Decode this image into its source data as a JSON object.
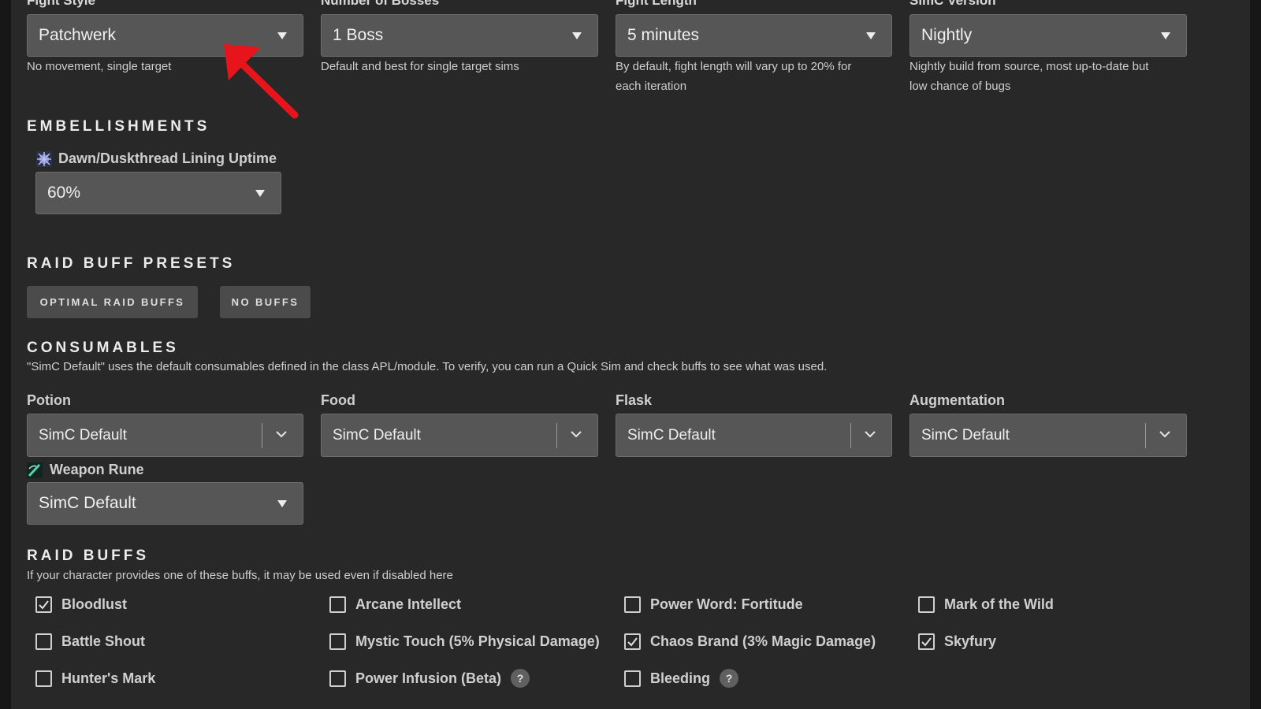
{
  "fight": {
    "style": {
      "label": "Fight Style",
      "value": "Patchwerk",
      "helper": "No movement, single target"
    },
    "bosses": {
      "label": "Number of Bosses",
      "value": "1 Boss",
      "helper": "Default and best for single target sims"
    },
    "length": {
      "label": "Fight Length",
      "value": "5 minutes",
      "helper_line1": "By default, fight length will vary up to 20% for",
      "helper_line2": "each iteration"
    },
    "version": {
      "label": "SimC Version",
      "value": "Nightly",
      "helper_line1": "Nightly build from source, most up-to-date but",
      "helper_line2": "low chance of bugs"
    }
  },
  "embellishments": {
    "heading": "EMBELLISHMENTS",
    "lining_label": "Dawn/Duskthread Lining Uptime",
    "lining_value": "60%",
    "lining_icon": "lining-icon"
  },
  "raid_buff_presets": {
    "heading": "RAID BUFF PRESETS",
    "optimal": "OPTIMAL RAID BUFFS",
    "none": "NO BUFFS"
  },
  "consumables": {
    "heading": "CONSUMABLES",
    "note": "\"SimC Default\" uses the default consumables defined in the class APL/module. To verify, you can run a Quick Sim and check buffs to see what was used.",
    "potion": {
      "label": "Potion",
      "value": "SimC Default"
    },
    "food": {
      "label": "Food",
      "value": "SimC Default"
    },
    "flask": {
      "label": "Flask",
      "value": "SimC Default"
    },
    "augmentation": {
      "label": "Augmentation",
      "value": "SimC Default"
    },
    "weapon_rune": {
      "label": "Weapon Rune",
      "value": "SimC Default",
      "icon": "weapon-rune-icon"
    }
  },
  "raid_buffs": {
    "heading": "RAID BUFFS",
    "note": "If your character provides one of these buffs, it may be used even if disabled here",
    "items": [
      {
        "label": "Bloodlust",
        "checked": true
      },
      {
        "label": "Arcane Intellect",
        "checked": false
      },
      {
        "label": "Power Word: Fortitude",
        "checked": false
      },
      {
        "label": "Mark of the Wild",
        "checked": false
      },
      {
        "label": "Battle Shout",
        "checked": false
      },
      {
        "label": "Mystic Touch (5% Physical Damage)",
        "checked": false
      },
      {
        "label": "Chaos Brand (3% Magic Damage)",
        "checked": true
      },
      {
        "label": "Skyfury",
        "checked": true
      },
      {
        "label": "Hunter's Mark",
        "checked": false
      },
      {
        "label": "Power Infusion (Beta)",
        "checked": false
      },
      {
        "label": "Bleeding",
        "checked": false
      }
    ],
    "help_glyph": "?"
  },
  "annotation": {
    "arrow_color": "#e8141b"
  }
}
